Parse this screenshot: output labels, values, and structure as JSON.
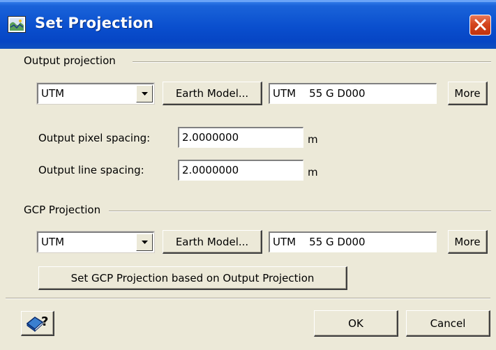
{
  "window": {
    "title": "Set Projection",
    "icon": "projection-app-icon",
    "close_icon": "close-icon"
  },
  "output_projection": {
    "group_label": "Output projection",
    "projection_type": "UTM",
    "earth_model_label": "Earth Model...",
    "projection_string": "UTM    55 G D000",
    "more_label": "More",
    "pixel_spacing_label": "Output pixel spacing:",
    "pixel_spacing_value": "2.0000000",
    "pixel_spacing_unit": "m",
    "line_spacing_label": "Output line spacing:",
    "line_spacing_value": "2.0000000",
    "line_spacing_unit": "m"
  },
  "gcp_projection": {
    "group_label": "GCP Projection",
    "projection_type": "UTM",
    "earth_model_label": "Earth Model...",
    "projection_string": "UTM    55 G D000",
    "more_label": "More",
    "set_from_output_label": "Set GCP Projection based on Output Projection"
  },
  "footer": {
    "help_icon": "help-book-icon",
    "ok_label": "OK",
    "cancel_label": "Cancel"
  },
  "colors": {
    "titlebar": "#0a4fce",
    "dialog_bg": "#ece9d8",
    "close_button": "#d4451e"
  }
}
